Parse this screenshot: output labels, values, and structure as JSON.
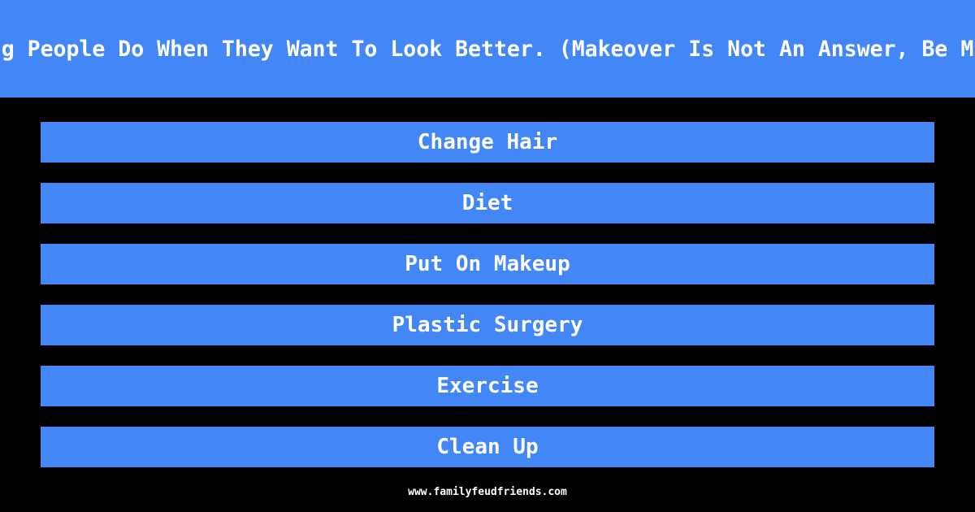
{
  "header": {
    "question": "g People Do When They Want To Look Better. (Makeover Is Not An Answer, Be M"
  },
  "answers": [
    "Change Hair",
    "Diet",
    "Put On Makeup",
    "Plastic Surgery",
    "Exercise",
    "Clean Up"
  ],
  "footer": {
    "site": "www.familyfeudfriends.com"
  },
  "colors": {
    "accent": "#4287f5",
    "background": "#000000",
    "text": "#ffffff"
  }
}
